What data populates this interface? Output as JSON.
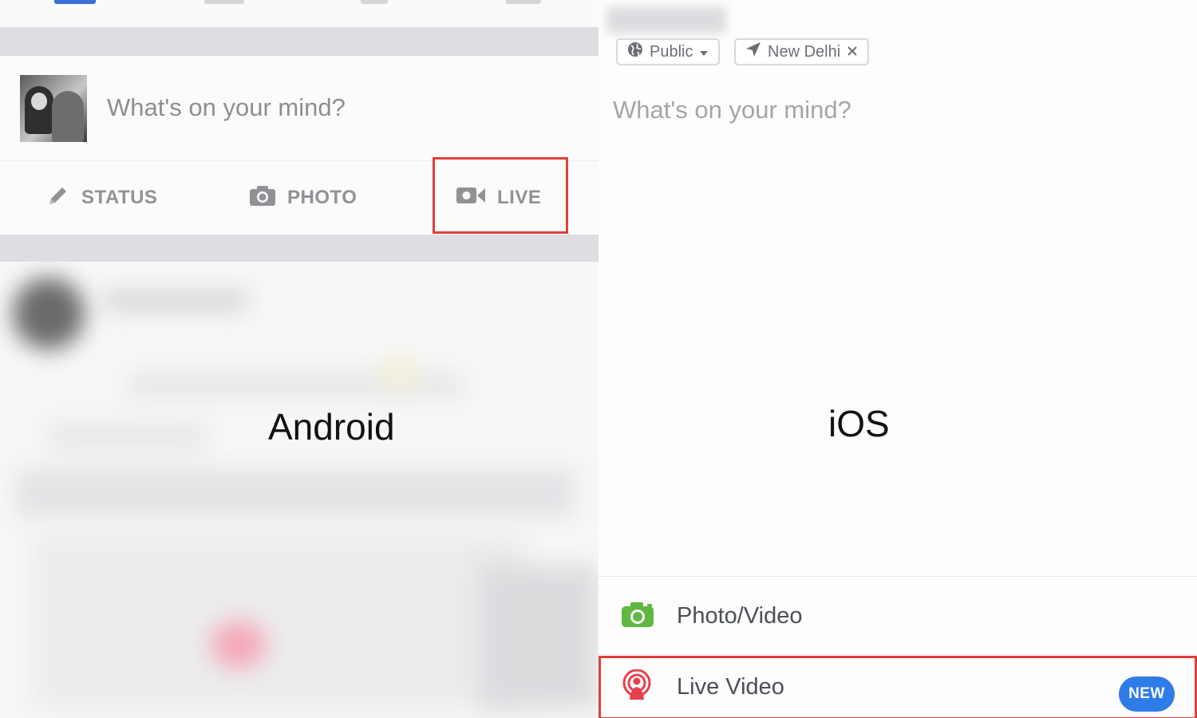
{
  "android": {
    "platform_label": "Android",
    "composer": {
      "placeholder": "What's on your mind?"
    },
    "actions": [
      {
        "label": "STATUS",
        "icon": "pencil-icon"
      },
      {
        "label": "PHOTO",
        "icon": "camera-icon"
      },
      {
        "label": "LIVE",
        "icon": "video-camera-icon",
        "highlighted": true
      }
    ]
  },
  "ios": {
    "platform_label": "iOS",
    "audience_chip": {
      "label": "Public",
      "icon": "globe-icon"
    },
    "location_chip": {
      "label": "New Delhi",
      "icon": "location-arrow-icon",
      "remove_icon": "close-icon"
    },
    "composer": {
      "placeholder": "What's on your mind?"
    },
    "options": [
      {
        "label": "Photo/Video",
        "icon": "camera-icon"
      },
      {
        "label": "Live Video",
        "icon": "live-broadcast-icon",
        "badge": "NEW",
        "highlighted": true
      }
    ]
  },
  "colors": {
    "facebook_blue": "#3b6fd8",
    "highlight_red": "#e0403a",
    "new_badge": "#2f7be8",
    "photo_green": "#5fb83f",
    "live_red": "#e8404c",
    "muted_text": "#909296"
  }
}
